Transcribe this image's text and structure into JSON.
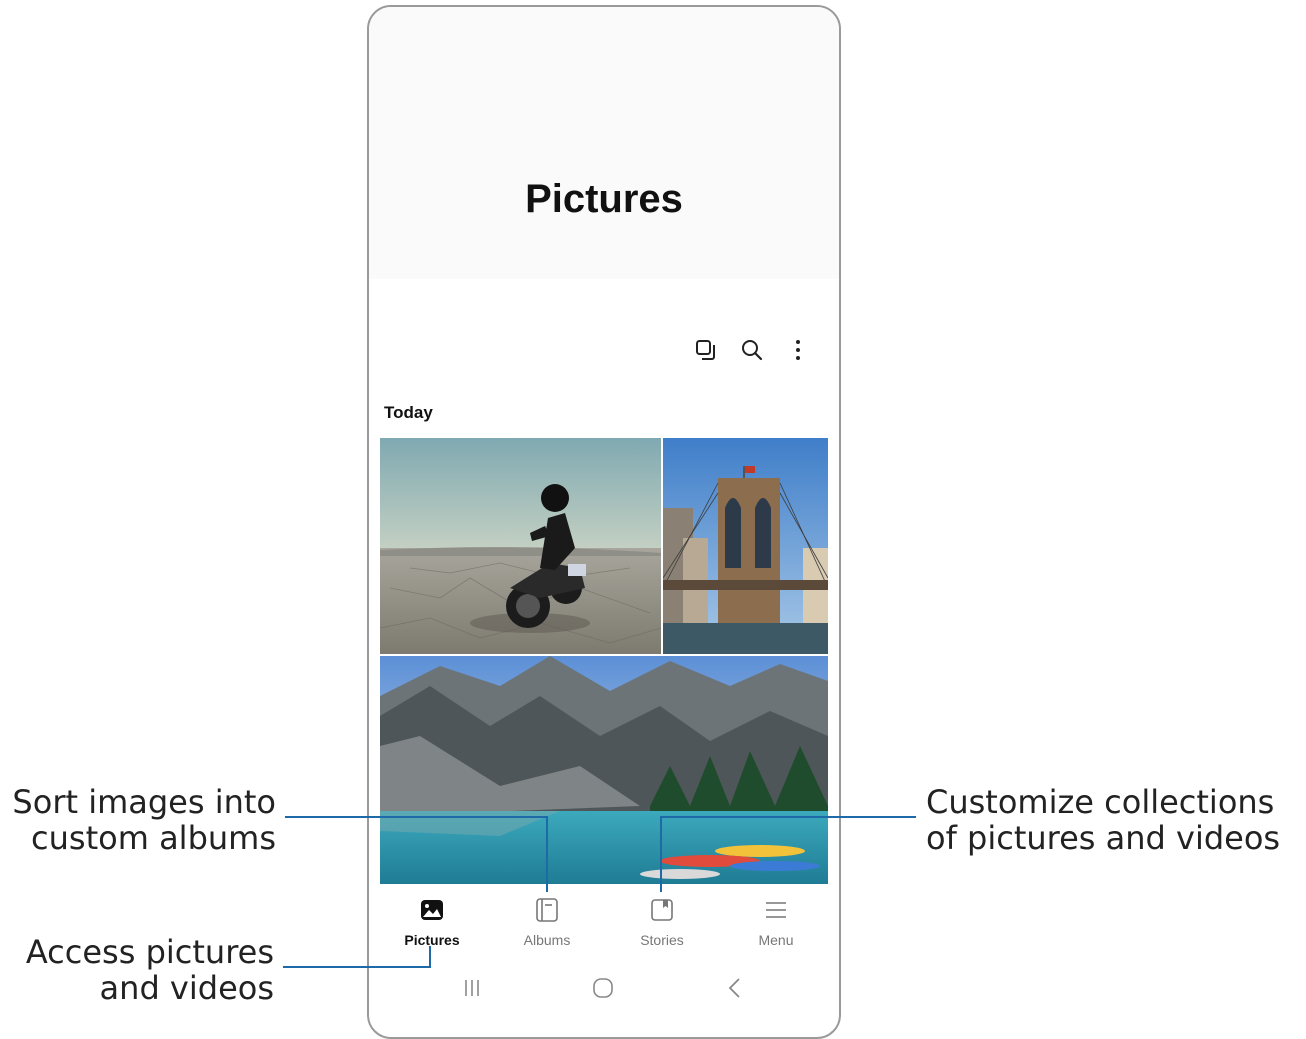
{
  "app": {
    "title": "Pictures"
  },
  "section": {
    "label": "Today"
  },
  "toolbar": {
    "icons": [
      "select-icon",
      "search-icon",
      "more-options-icon"
    ]
  },
  "nav": {
    "items": [
      {
        "label": "Pictures",
        "icon": "pictures-icon",
        "active": true
      },
      {
        "label": "Albums",
        "icon": "albums-icon",
        "active": false
      },
      {
        "label": "Stories",
        "icon": "stories-icon",
        "active": false
      },
      {
        "label": "Menu",
        "icon": "menu-icon",
        "active": false
      }
    ]
  },
  "system_nav": {
    "icons": [
      "recents-icon",
      "home-icon",
      "back-icon"
    ]
  },
  "callouts": {
    "albums": [
      "Sort images into",
      "custom albums"
    ],
    "stories": [
      "Customize collections",
      "of pictures and videos"
    ],
    "pictures": [
      "Access pictures",
      "and videos"
    ]
  },
  "colors": {
    "leader_line": "#1e6aa8",
    "frame": "#9a9a9a"
  }
}
